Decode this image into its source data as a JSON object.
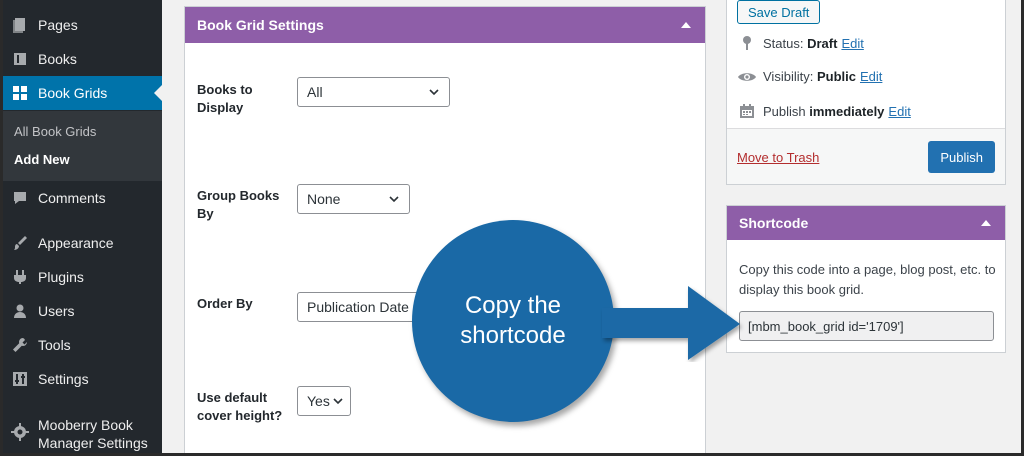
{
  "sidebar": {
    "items": [
      {
        "label": "Pages",
        "icon": "pages-icon"
      },
      {
        "label": "Books",
        "icon": "books-icon"
      },
      {
        "label": "Book Grids",
        "icon": "grid-icon"
      },
      {
        "label": "Comments",
        "icon": "comments-icon"
      },
      {
        "label": "Appearance",
        "icon": "appearance-icon"
      },
      {
        "label": "Plugins",
        "icon": "plugins-icon"
      },
      {
        "label": "Users",
        "icon": "users-icon"
      },
      {
        "label": "Tools",
        "icon": "tools-icon"
      },
      {
        "label": "Settings",
        "icon": "settings-icon"
      },
      {
        "label_line1": "Mooberry Book",
        "label_line2": "Manager Settings",
        "icon": "gear-icon"
      }
    ],
    "submenu": [
      "All Book Grids",
      "Add New"
    ],
    "active": "Book Grids",
    "current_sub": "Add New"
  },
  "main": {
    "title": "Book Grid Settings",
    "fields": [
      {
        "label_line1": "Books to",
        "label_line2": "Display",
        "value": "All"
      },
      {
        "label_line1": "Group Books",
        "label_line2": "By",
        "value": "None"
      },
      {
        "label_line1": "Order By",
        "label_line2": "",
        "value": "Publication Date"
      },
      {
        "label_line1": "Use default",
        "label_line2": "cover height?",
        "value": "Yes"
      }
    ]
  },
  "publish": {
    "save_draft": "Save Draft",
    "status_label": "Status:",
    "status_value": "Draft",
    "visibility_label": "Visibility:",
    "visibility_value": "Public",
    "publish_label": "Publish",
    "publish_value": "immediately",
    "edit": "Edit",
    "trash": "Move to Trash",
    "publish_button": "Publish"
  },
  "shortcode": {
    "title": "Shortcode",
    "description": "Copy this code into a page, blog post, etc. to display this book grid.",
    "value": "[mbm_book_grid id='1709']"
  },
  "callout": {
    "line1": "Copy the",
    "line2": "shortcode"
  },
  "colors": {
    "sidebar_bg": "#23282d",
    "active_blue": "#0073aa",
    "header_purple": "#8e5ea8",
    "callout_blue": "#1a69a6"
  }
}
